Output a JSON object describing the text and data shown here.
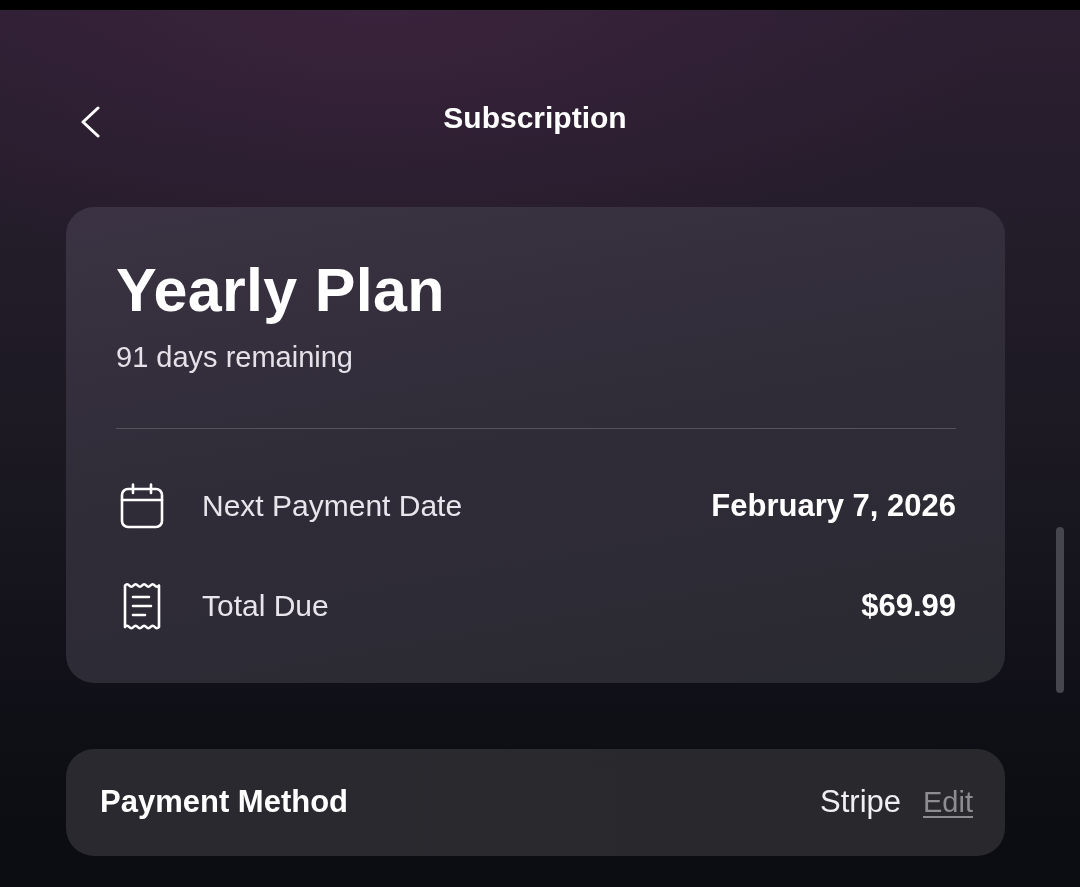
{
  "header": {
    "title": "Subscription"
  },
  "plan": {
    "name": "Yearly Plan",
    "remaining": "91 days remaining",
    "details": [
      {
        "kind": "calendar",
        "label": "Next Payment Date",
        "value": "February 7, 2026"
      },
      {
        "kind": "receipt",
        "label": "Total Due",
        "value": "$69.99"
      }
    ]
  },
  "payment_method": {
    "label": "Payment Method",
    "value": "Stripe",
    "action": "Edit"
  }
}
